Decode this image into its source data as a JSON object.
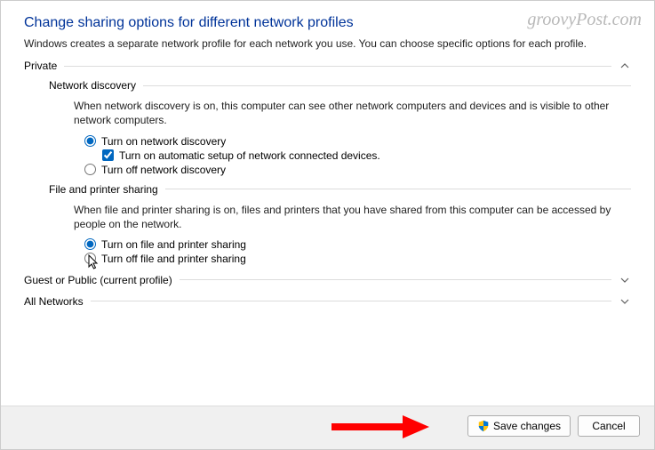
{
  "watermark": "groovyPost.com",
  "title": "Change sharing options for different network profiles",
  "subtitle": "Windows creates a separate network profile for each network you use. You can choose specific options for each profile.",
  "sections": {
    "private": {
      "label": "Private",
      "network_discovery": {
        "label": "Network discovery",
        "desc": "When network discovery is on, this computer can see other network computers and devices and is visible to other network computers.",
        "opt_on": "Turn on network discovery",
        "opt_auto": "Turn on automatic setup of network connected devices.",
        "opt_off": "Turn off network discovery"
      },
      "file_printer": {
        "label": "File and printer sharing",
        "desc": "When file and printer sharing is on, files and printers that you have shared from this computer can be accessed by people on the network.",
        "opt_on": "Turn on file and printer sharing",
        "opt_off": "Turn off file and printer sharing"
      }
    },
    "guest": {
      "label": "Guest or Public (current profile)"
    },
    "all": {
      "label": "All Networks"
    }
  },
  "buttons": {
    "save": "Save changes",
    "cancel": "Cancel"
  }
}
